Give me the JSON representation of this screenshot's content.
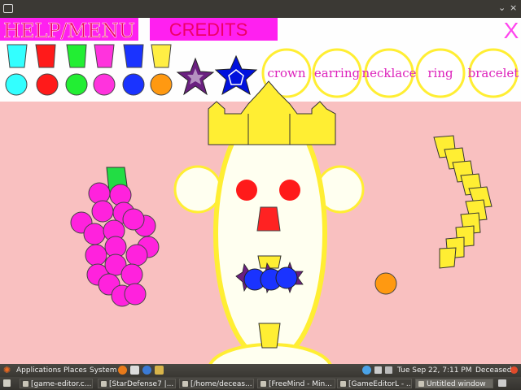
{
  "window": {
    "close_glyph": "×",
    "menu_glyph": "⌄"
  },
  "toolbar": {
    "help_menu_label": "HELP/MENU",
    "credits_label": "CREDITS",
    "close_label": "X",
    "color_swatches": [
      {
        "name": "cyan",
        "hex": "#33ffff"
      },
      {
        "name": "red",
        "hex": "#ff1a1a"
      },
      {
        "name": "green",
        "hex": "#22ee33"
      },
      {
        "name": "magenta",
        "hex": "#ff33dd"
      },
      {
        "name": "blue",
        "hex": "#1a33ff"
      },
      {
        "name": "orange",
        "hex": "#ff9911"
      }
    ],
    "star_tools": [
      "purple-star-icon",
      "blue-pentagon-star-icon"
    ],
    "jewelry_buttons": [
      "crown",
      "earring",
      "necklace",
      "ring",
      "bracelet"
    ]
  },
  "canvas": {
    "background": "#f9c0c0",
    "pieces": [
      "grapes",
      "crown",
      "face",
      "necklace-beads",
      "banana",
      "orange"
    ]
  },
  "panel": {
    "applications": "Applications",
    "places": "Places",
    "system": "System",
    "clock": "Tue Sep 22,  7:11 PM",
    "user": "Deceased"
  },
  "taskbar": {
    "items": [
      "[game-editor.c...",
      "[StarDefense7 |...",
      "[/home/deceas...",
      "[FreeMind - Min...",
      "[GameEditorL - ...",
      "Untitled window"
    ]
  }
}
